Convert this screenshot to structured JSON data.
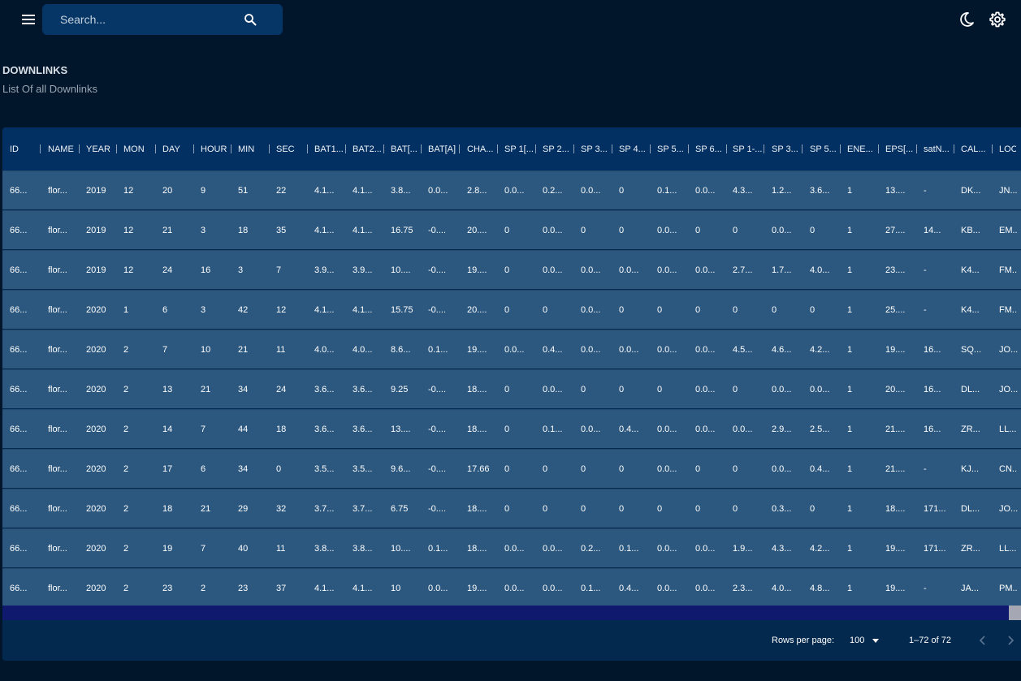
{
  "search": {
    "placeholder": "Search..."
  },
  "page": {
    "title": "DOWNLINKS",
    "subtitle": "List Of all Downlinks"
  },
  "table": {
    "columns": [
      "ID",
      "NAME",
      "YEAR",
      "MON",
      "DAY",
      "HOUR",
      "MIN",
      "SEC",
      "BAT1...",
      "BAT2...",
      "BAT[...",
      "BAT[A]",
      "CHA...",
      "SP 1[...",
      "SP 2...",
      "SP 3...",
      "SP 4...",
      "SP 5...",
      "SP 6...",
      "SP 1-...",
      "SP 3...",
      "SP 5...",
      "ENE...",
      "EPS[...",
      "satN...",
      "CAL...",
      "LOC..."
    ],
    "rows": [
      [
        "66...",
        "flor...",
        "2019",
        "12",
        "20",
        "9",
        "51",
        "22",
        "4.1...",
        "4.1...",
        "3.8...",
        "0.0...",
        "2.8...",
        "0.0...",
        "0.2...",
        "0.0...",
        "0",
        "0.1...",
        "0.0...",
        "4.3...",
        "1.2...",
        "3.6...",
        "1",
        "13....",
        "-",
        "DK...",
        "JN..."
      ],
      [
        "66...",
        "flor...",
        "2019",
        "12",
        "21",
        "3",
        "18",
        "35",
        "4.1...",
        "4.1...",
        "16.75",
        "-0....",
        "20....",
        "0",
        "0.0...",
        "0",
        "0",
        "0.0...",
        "0",
        "0",
        "0.0...",
        "0",
        "1",
        "27....",
        "14...",
        "KB...",
        "EM..."
      ],
      [
        "66...",
        "flor...",
        "2019",
        "12",
        "24",
        "16",
        "3",
        "7",
        "3.9...",
        "3.9...",
        "10....",
        "-0....",
        "19....",
        "0",
        "0.0...",
        "0.0...",
        "0.0...",
        "0.0...",
        "0.0...",
        "2.7...",
        "1.7...",
        "4.0...",
        "1",
        "23....",
        "-",
        "K4...",
        "FM..."
      ],
      [
        "66...",
        "flor...",
        "2020",
        "1",
        "6",
        "3",
        "42",
        "12",
        "4.1...",
        "4.1...",
        "15.75",
        "-0....",
        "20....",
        "0",
        "0",
        "0.0...",
        "0",
        "0",
        "0",
        "0",
        "0",
        "0",
        "1",
        "25....",
        "-",
        "K4...",
        "FM..."
      ],
      [
        "66...",
        "flor...",
        "2020",
        "2",
        "7",
        "10",
        "21",
        "11",
        "4.0...",
        "4.0...",
        "8.6...",
        "0.1...",
        "19....",
        "0.0...",
        "0.4...",
        "0.0...",
        "0.0...",
        "0.0...",
        "0.0...",
        "4.5...",
        "4.6...",
        "4.2...",
        "1",
        "19....",
        "16...",
        "SQ...",
        "JO..."
      ],
      [
        "66...",
        "flor...",
        "2020",
        "2",
        "13",
        "21",
        "34",
        "24",
        "3.6...",
        "3.6...",
        "9.25",
        "-0....",
        "18....",
        "0",
        "0.0...",
        "0",
        "0",
        "0",
        "0.0...",
        "0",
        "0.0...",
        "0.0...",
        "1",
        "20....",
        "16...",
        "DL...",
        "JO..."
      ],
      [
        "66...",
        "flor...",
        "2020",
        "2",
        "14",
        "7",
        "44",
        "18",
        "3.6...",
        "3.6...",
        "13....",
        "-0....",
        "18....",
        "0",
        "0.1...",
        "0.0...",
        "0.4...",
        "0.0...",
        "0.0...",
        "0.0...",
        "2.9...",
        "2.5...",
        "1",
        "21....",
        "16...",
        "ZR...",
        "LL..."
      ],
      [
        "66...",
        "flor...",
        "2020",
        "2",
        "17",
        "6",
        "34",
        "0",
        "3.5...",
        "3.5...",
        "9.6...",
        "-0....",
        "17.66",
        "0",
        "0",
        "0",
        "0",
        "0.0...",
        "0",
        "0",
        "0.0...",
        "0.4...",
        "1",
        "21....",
        "-",
        "KJ...",
        "CN..."
      ],
      [
        "66...",
        "flor...",
        "2020",
        "2",
        "18",
        "21",
        "29",
        "32",
        "3.7...",
        "3.7...",
        "6.75",
        "-0....",
        "18....",
        "0",
        "0",
        "0",
        "0",
        "0",
        "0",
        "0",
        "0.3...",
        "0",
        "1",
        "18....",
        "171...",
        "DL...",
        "JO..."
      ],
      [
        "66...",
        "flor...",
        "2020",
        "2",
        "19",
        "7",
        "40",
        "11",
        "3.8...",
        "3.8...",
        "10....",
        "0.1...",
        "18....",
        "0.0...",
        "0.0...",
        "0.2...",
        "0.1...",
        "0.0...",
        "0.0...",
        "1.9...",
        "4.3...",
        "4.2...",
        "1",
        "19....",
        "171...",
        "ZR...",
        "LL..."
      ],
      [
        "66...",
        "flor...",
        "2020",
        "2",
        "23",
        "2",
        "23",
        "37",
        "4.1...",
        "4.1...",
        "10",
        "0.0...",
        "19....",
        "0.0...",
        "0.0...",
        "0.1...",
        "0.4...",
        "0.0...",
        "0.0...",
        "2.3...",
        "4.0...",
        "4.8...",
        "1",
        "19....",
        "-",
        "JA...",
        "PM..."
      ]
    ]
  },
  "pagination": {
    "rows_per_page_label": "Rows per page:",
    "rows_per_page_value": "100",
    "range_text": "1–72 of 72"
  },
  "icons": {
    "menu": "menu-icon",
    "search": "search-icon",
    "theme": "dark-mode-moon-icon",
    "settings": "gear-icon",
    "prev": "chevron-left-icon",
    "next": "chevron-right-icon"
  }
}
